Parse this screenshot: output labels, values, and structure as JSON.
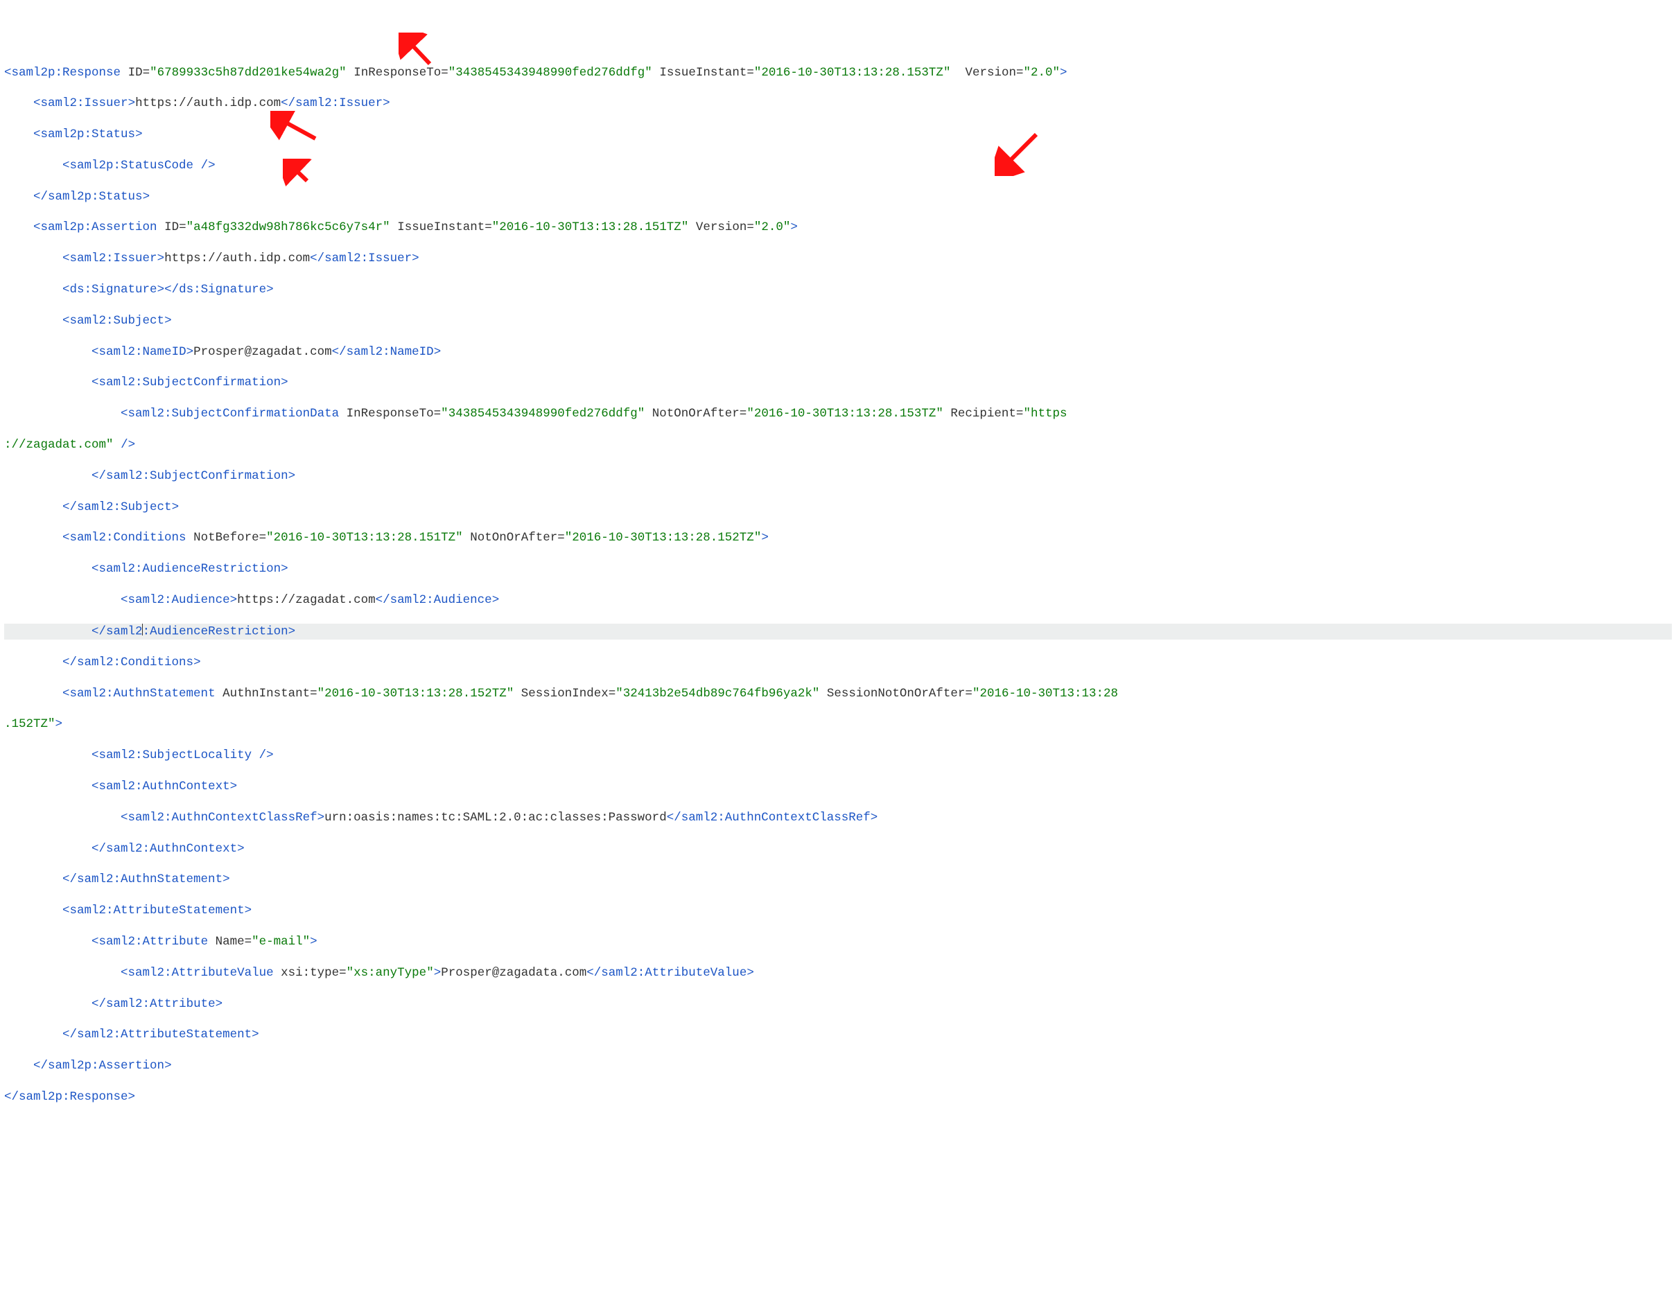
{
  "xml": {
    "response_tag": "saml2p:Response",
    "response_id_attr": "ID",
    "response_id_val": "6789933c5h87dd201ke54wa2g",
    "inresponseto_attr": "InResponseTo",
    "inresponseto_val": "3438545343948990fed276ddfg",
    "issueinstant_attr": "IssueInstant",
    "issueinstant_val": "2016-10-30T13:13:28.153TZ",
    "version_attr": "Version",
    "version_val": "2.0",
    "issuer_tag": "saml2:Issuer",
    "issuer_text": "https://auth.idp.com",
    "status_tag": "saml2p:Status",
    "statuscode_tag": "saml2p:StatusCode",
    "assertion_tag": "saml2p:Assertion",
    "assertion_id_val": "a48fg332dw98h786kc5c6y7s4r",
    "assertion_issueinstant_val": "2016-10-30T13:13:28.151TZ",
    "assertion_issuer_text": "https://auth.idp.com",
    "signature_tag": "ds:Signature",
    "subject_tag": "saml2:Subject",
    "nameid_tag": "saml2:NameID",
    "nameid_text": "Prosper@zagadat.com",
    "subjectconf_tag": "saml2:SubjectConfirmation",
    "subjectconfdata_tag": "saml2:SubjectConfirmationData",
    "subjectconfdata_inresponseto_val": "3438545343948990fed276ddfg",
    "notonorafter_attr": "NotOnOrAfter",
    "subjectconfdata_notonorafter_val": "2016-10-30T13:13:28.153TZ",
    "recipient_attr": "Recipient",
    "recipient_val_part1": "https",
    "recipient_val_part2": "://zagadat.com",
    "conditions_tag": "saml2:Conditions",
    "notbefore_attr": "NotBefore",
    "notbefore_val": "2016-10-30T13:13:28.151TZ",
    "conditions_notonorafter_val": "2016-10-30T13:13:28.152TZ",
    "audiencerestriction_tag": "saml2:AudienceRestriction",
    "audiencerestriction_close_part1": "saml2",
    "audiencerestriction_close_part2": ":AudienceRestriction",
    "audience_tag": "saml2:Audience",
    "audience_text": "https://zagadat.com",
    "authnstatement_tag": "saml2:AuthnStatement",
    "authninstant_attr": "AuthnInstant",
    "authninstant_val": "2016-10-30T13:13:28.152TZ",
    "sessionindex_attr": "SessionIndex",
    "sessionindex_val": "32413b2e54db89c764fb96ya2k",
    "sessionnotonorafter_attr": "SessionNotOnOrAfter",
    "sessionnotonorafter_val_part1": "2016-10-30T13:13:28",
    "sessionnotonorafter_val_part2": ".152TZ",
    "subjectlocality_tag": "saml2:SubjectLocality",
    "authncontext_tag": "saml2:AuthnContext",
    "authncontextclassref_tag": "saml2:AuthnContextClassRef",
    "authncontextclassref_text": "urn:oasis:names:tc:SAML:2.0:ac:classes:Password",
    "attributestatement_tag": "saml2:AttributeStatement",
    "attribute_tag": "saml2:Attribute",
    "attribute_name_attr": "Name",
    "attribute_name_val": "e-mail",
    "attributevalue_tag": "saml2:AttributeValue",
    "xsitype_attr": "xsi:type",
    "xsitype_val": "xs:anyType",
    "attributevalue_text": "Prosper@zagadata.com"
  }
}
